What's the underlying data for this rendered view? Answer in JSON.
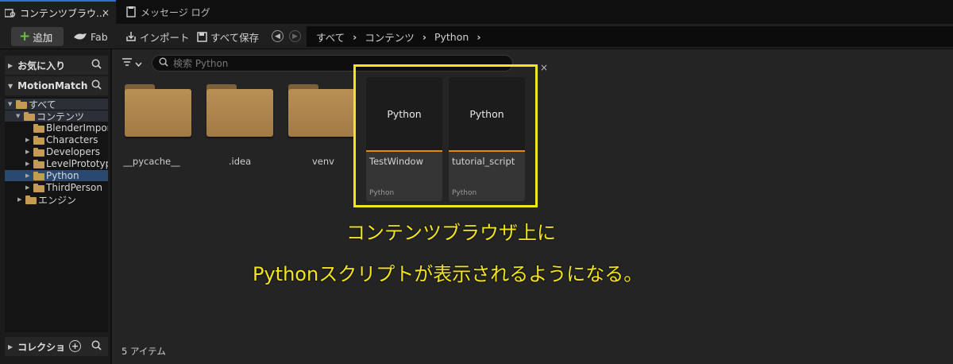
{
  "tabs": [
    {
      "label": "コンテンツブラウ...",
      "close": "×"
    },
    {
      "label": "メッセージ ログ"
    }
  ],
  "toolbar": {
    "add_label": "追加",
    "fab_label": "Fab",
    "import_label": "インポート",
    "saveall_label": "すべて保存"
  },
  "breadcrumb": [
    "すべて",
    "コンテンツ",
    "Python"
  ],
  "sidebar": {
    "favorites": "お気に入り",
    "project": "MotionMatch",
    "collections": "コレクショ",
    "tree": [
      {
        "label": "すべて"
      },
      {
        "label": "コンテンツ"
      },
      {
        "label": "BlenderImpor"
      },
      {
        "label": "Characters"
      },
      {
        "label": "Developers"
      },
      {
        "label": "LevelPrototyp"
      },
      {
        "label": "Python"
      },
      {
        "label": "ThirdPerson"
      },
      {
        "label": "エンジン"
      }
    ]
  },
  "search": {
    "placeholder": "検索 Python",
    "clear": "×"
  },
  "folders": [
    "__pycache__",
    ".idea",
    "venv"
  ],
  "assets": [
    {
      "thumb": "Python",
      "name": "TestWindow",
      "type": "Python"
    },
    {
      "thumb": "Python",
      "name": "tutorial_script",
      "type": "Python"
    }
  ],
  "annotation": {
    "line1": "コンテンツブラウザ上に",
    "line2": "Pythonスクリプトが表示されるようになる。"
  },
  "status": {
    "item_count": "5 アイテム"
  },
  "colors": {
    "accent": "#2d6fd6",
    "folder": "#b98f55",
    "asset_bar": "#e08b10",
    "highlight": "#f2e51d",
    "selected": "#2a4970"
  }
}
